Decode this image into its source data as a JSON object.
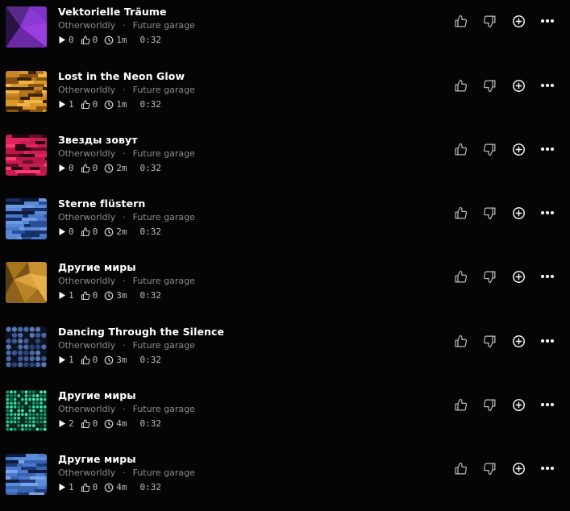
{
  "tracks": [
    {
      "title": "Vektorielle Träume",
      "artist": "Otherworldly",
      "genre": "Future garage",
      "plays": "0",
      "likes": "0",
      "age": "1m",
      "duration": "0:32",
      "art": "purple"
    },
    {
      "title": "Lost in the Neon Glow",
      "artist": "Otherworldly",
      "genre": "Future garage",
      "plays": "1",
      "likes": "0",
      "age": "1m",
      "duration": "0:32",
      "art": "amber-stripes"
    },
    {
      "title": "Звезды зовут",
      "artist": "Otherworldly",
      "genre": "Future garage",
      "plays": "0",
      "likes": "0",
      "age": "2m",
      "duration": "0:32",
      "art": "pink-stripes"
    },
    {
      "title": "Sterne flüstern",
      "artist": "Otherworldly",
      "genre": "Future garage",
      "plays": "0",
      "likes": "0",
      "age": "2m",
      "duration": "0:32",
      "art": "blue-stripes"
    },
    {
      "title": "Другие миры",
      "artist": "Otherworldly",
      "genre": "Future garage",
      "plays": "1",
      "likes": "0",
      "age": "3m",
      "duration": "0:32",
      "art": "gold-polygons"
    },
    {
      "title": "Dancing Through the Silence",
      "artist": "Otherworldly",
      "genre": "Future garage",
      "plays": "1",
      "likes": "0",
      "age": "3m",
      "duration": "0:32",
      "art": "blue-dots"
    },
    {
      "title": "Другие миры",
      "artist": "Otherworldly",
      "genre": "Future garage",
      "plays": "2",
      "likes": "0",
      "age": "4m",
      "duration": "0:32",
      "art": "green-dots"
    },
    {
      "title": "Другие миры",
      "artist": "Otherworldly",
      "genre": "Future garage",
      "plays": "1",
      "likes": "0",
      "age": "4m",
      "duration": "0:32",
      "art": "blue-stripes-2"
    }
  ],
  "icons": {
    "play": "play-icon",
    "likes": "thumbs-up-icon",
    "age": "clock-icon",
    "like_action": "like-icon",
    "dislike_action": "dislike-icon",
    "add_action": "add-to-playlist-icon",
    "more_action": "more-options-icon"
  },
  "colors": {
    "background": "#050505",
    "title": "#ffffff",
    "meta": "#8b8b8b",
    "stats": "#bdbdbd",
    "icon": "#cfcfcf"
  }
}
